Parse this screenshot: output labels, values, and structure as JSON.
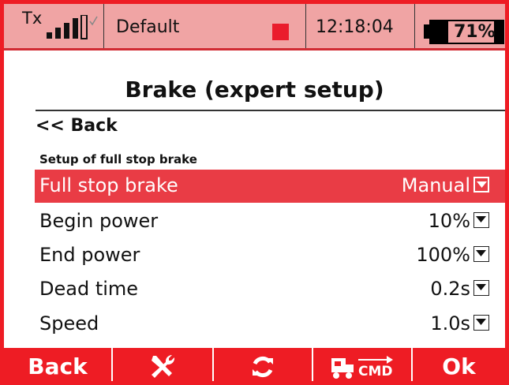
{
  "status_bar": {
    "tx_label": "Tx",
    "model_name": "Default",
    "time": "12:18:04",
    "battery_percent": "71%",
    "battery_level": 0.71,
    "signal_icon": "signal-bars-icon",
    "recording_icon": "record-square-icon"
  },
  "page": {
    "title": "Brake (expert setup)",
    "back_label": "<< Back",
    "section_heading": "Setup of full stop brake"
  },
  "rows": [
    {
      "label": "Full stop brake",
      "value": "Manual",
      "selected": true
    },
    {
      "label": "Begin power",
      "value": "10%",
      "selected": false
    },
    {
      "label": "End power",
      "value": "100%",
      "selected": false
    },
    {
      "label": "Dead time",
      "value": "0.2s",
      "selected": false
    },
    {
      "label": "Speed",
      "value": "1.0s",
      "selected": false
    }
  ],
  "bottom_bar": {
    "back_label": "Back",
    "tools_icon": "wrench-screwdriver-icon",
    "refresh_icon": "refresh-icon",
    "cmd_label": "CMD",
    "ok_label": "Ok"
  },
  "colors": {
    "accent": "#ee1c24",
    "status_bg": "#f0a4a4",
    "selected_row": "#e93c45"
  }
}
